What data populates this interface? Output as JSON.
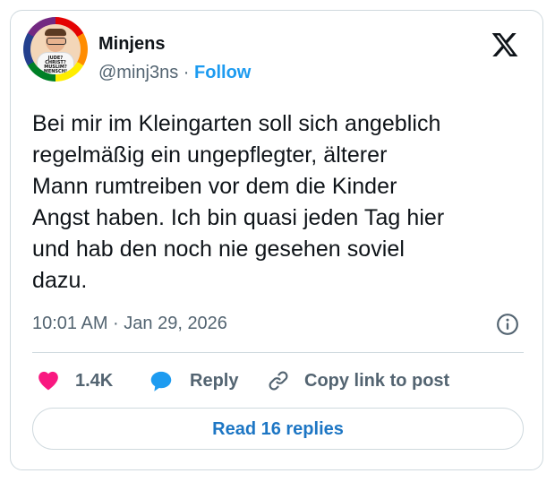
{
  "author": {
    "name": "Minjens",
    "handle": "@minj3ns",
    "separator": "·",
    "follow_label": "Follow",
    "avatar_shirt_lines": [
      "JUDE?",
      "CHRIST?",
      "MUSLIM?",
      "MENSCH!"
    ]
  },
  "tweet": {
    "text": "Bei mir im Kleingarten soll sich angeblich\nregelmäßig ein ungepflegter, älterer\nMann rumtreiben vor dem die Kinder\nAngst haben. Ich bin quasi jeden Tag hier\nund hab den noch nie gesehen soviel\ndazu.",
    "timestamp": "10:01 AM · Jan 29, 2026"
  },
  "actions": {
    "likes_count": "1.4K",
    "reply_label": "Reply",
    "copy_link_label": "Copy link to post",
    "read_replies_label": "Read 16 replies"
  },
  "icons": {
    "platform": "x-logo-icon",
    "info": "info-icon",
    "like": "heart-icon",
    "reply": "speech-bubble-icon",
    "copy": "link-icon"
  },
  "colors": {
    "text_primary": "#0f1419",
    "text_secondary": "#536471",
    "accent_blue": "#1d9bf0",
    "like_pink": "#f91880",
    "reply_blue": "#1d9bf0",
    "border": "#cfd9de",
    "read_replies_text": "#1d76c4"
  }
}
